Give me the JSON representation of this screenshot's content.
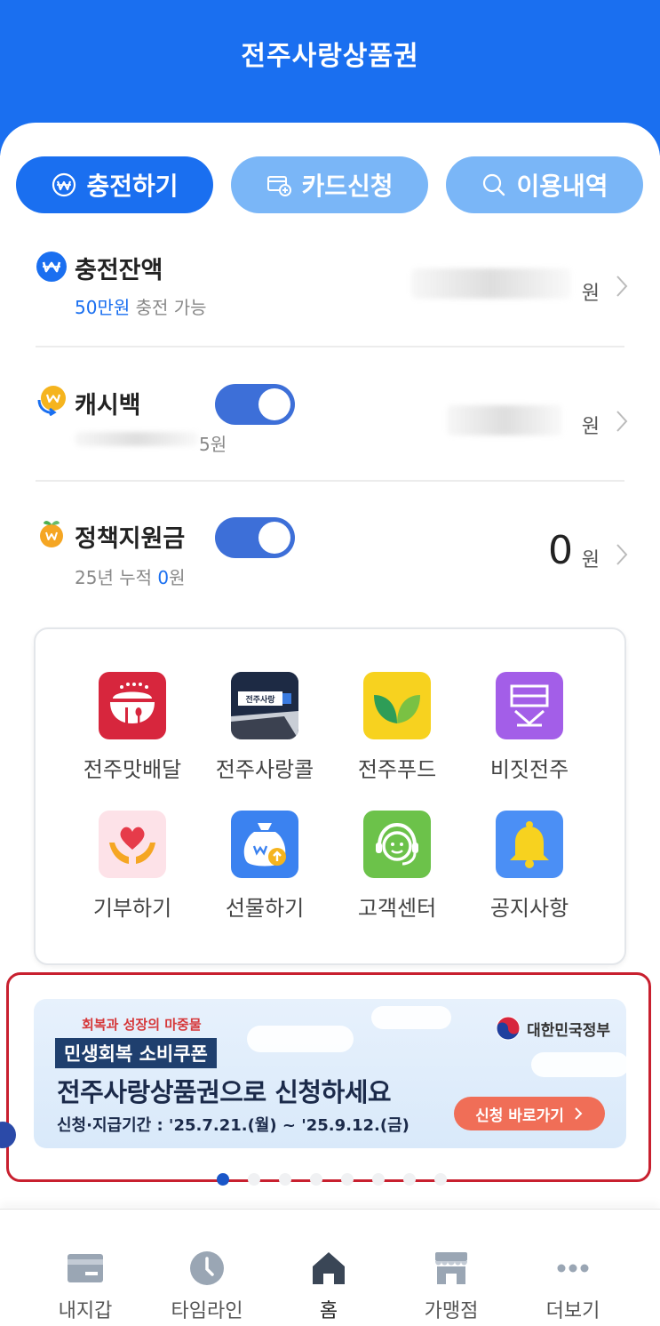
{
  "header": {
    "title": "전주사랑상품권"
  },
  "actions": [
    {
      "label": "충전하기",
      "icon": "won-circle-icon",
      "style": "primary"
    },
    {
      "label": "카드신청",
      "icon": "card-plus-icon",
      "style": "secondary"
    },
    {
      "label": "이용내역",
      "icon": "search-icon",
      "style": "secondary"
    }
  ],
  "balance": {
    "name": "충전잔액",
    "sub_highlight": "50만원",
    "sub_rest": " 충전 가능",
    "unit": "원"
  },
  "cashback": {
    "name": "캐시백",
    "sub": "5원",
    "unit": "원",
    "toggle_on": true
  },
  "policy": {
    "name": "정책지원금",
    "sub_prefix": "25년 누적 ",
    "sub_highlight": "0",
    "sub_suffix": "원",
    "amount": "0",
    "unit": "원",
    "toggle_on": true
  },
  "menu": [
    {
      "label": "전주맛배달",
      "icon": "food-delivery-icon"
    },
    {
      "label": "전주사랑콜",
      "icon": "taxi-call-icon"
    },
    {
      "label": "전주푸드",
      "icon": "leaf-icon"
    },
    {
      "label": "비짓전주",
      "icon": "visit-jeonju-icon"
    },
    {
      "label": "기부하기",
      "icon": "donation-heart-icon"
    },
    {
      "label": "선물하기",
      "icon": "gift-bag-icon"
    },
    {
      "label": "고객센터",
      "icon": "headset-icon"
    },
    {
      "label": "공지사항",
      "icon": "bell-icon"
    }
  ],
  "banner": {
    "small": "회복과 성장의 마중물",
    "tag": "민생회복 소비쿠폰",
    "main": "전주사랑상품권으로 신청하세요",
    "period": "신청·지급기간 : '25.7.21.(월) ~ '25.9.12.(금)",
    "gov": "대한민국정부",
    "cta": "신청 바로가기",
    "colors": {
      "cta": "#f06e57",
      "tag": "#1f3f6e",
      "frame": "#c8202f"
    }
  },
  "pagination": {
    "count": 8,
    "active": 1
  },
  "bottom_nav": [
    {
      "label": "내지갑",
      "icon": "wallet-icon"
    },
    {
      "label": "타임라인",
      "icon": "clock-icon"
    },
    {
      "label": "홈",
      "icon": "home-icon",
      "active": true
    },
    {
      "label": "가맹점",
      "icon": "store-icon"
    },
    {
      "label": "더보기",
      "icon": "more-icon"
    }
  ],
  "colors": {
    "brand": "#1a6ff0",
    "brand_light": "#7ab6f7",
    "toggle": "#3d6fd8"
  }
}
